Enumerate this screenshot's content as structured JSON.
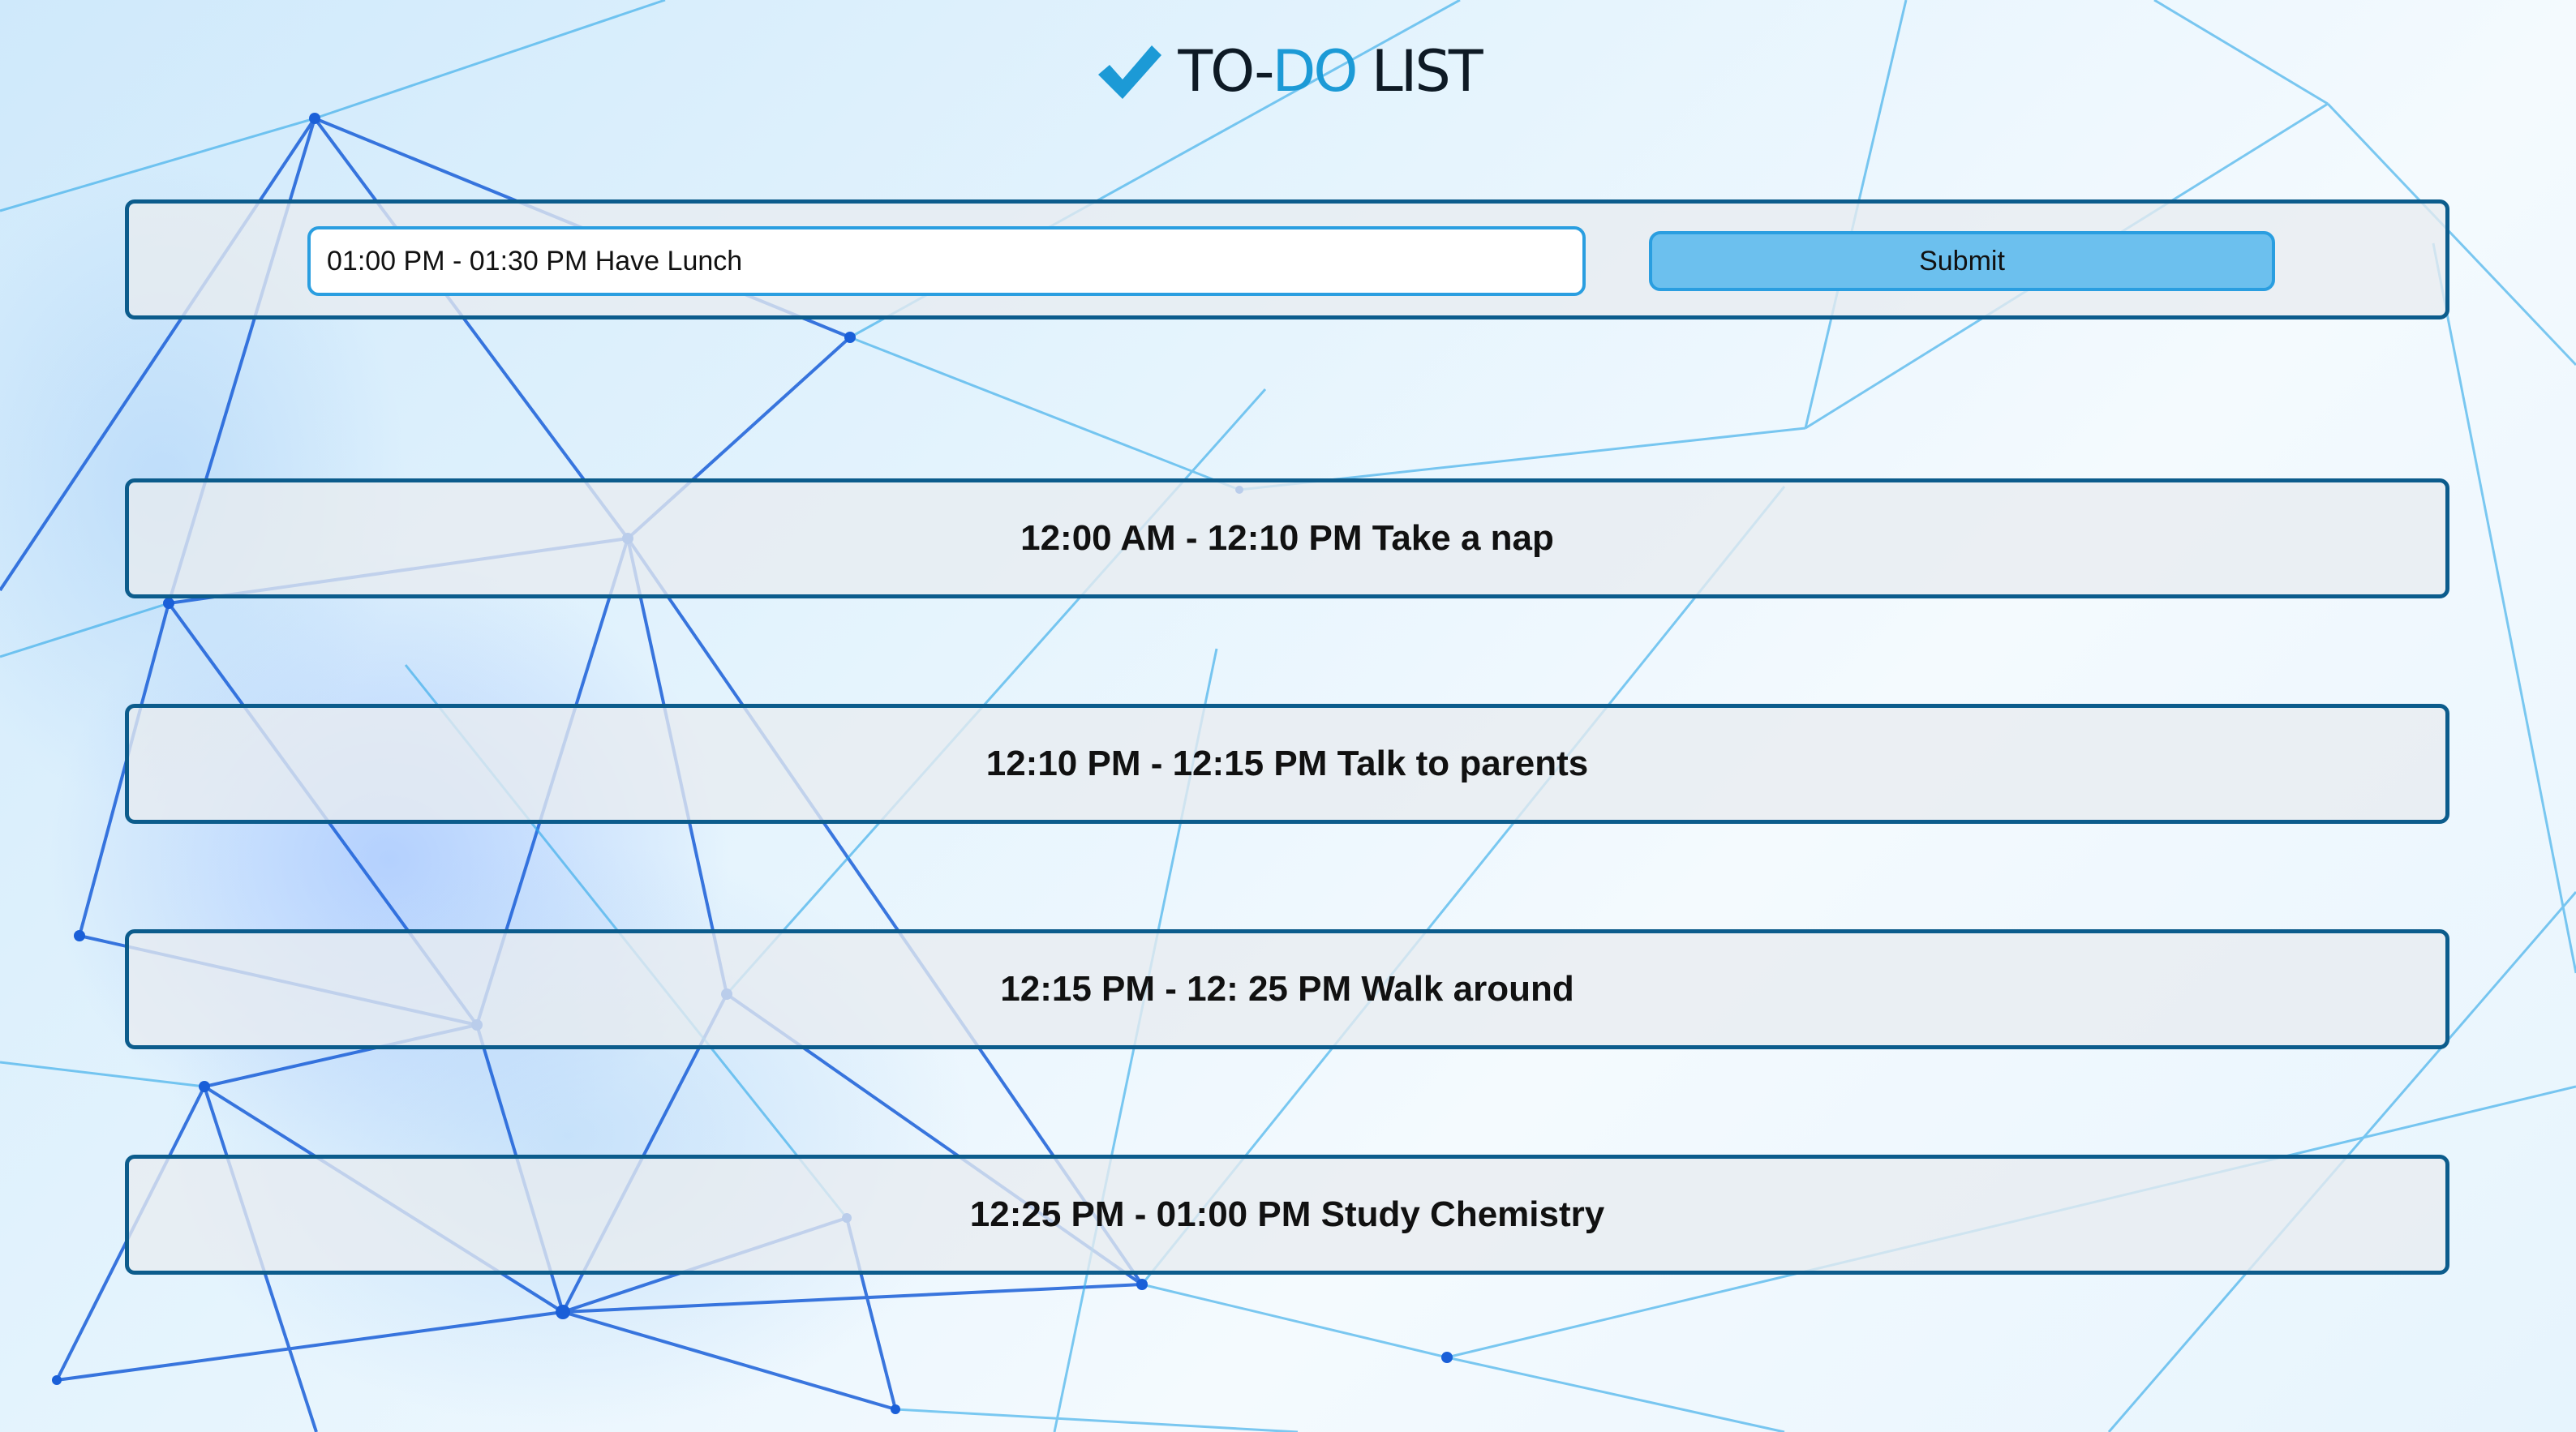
{
  "app": {
    "title_part1": "TO-",
    "title_part2": "DO",
    "title_part3": " LIST",
    "accent_color": "#1c9ad6",
    "logo_icon": "checkmark-icon"
  },
  "form": {
    "input_value": "01:00 PM - 01:30 PM Have Lunch",
    "submit_label": "Submit"
  },
  "todos": [
    {
      "text": "12:00 AM - 12:10 PM Take a nap"
    },
    {
      "text": "12:10 PM - 12:15 PM Talk to parents"
    },
    {
      "text": "12:15 PM - 12: 25 PM Walk around"
    },
    {
      "text": "12:25 PM - 01:00 PM Study Chemistry"
    }
  ],
  "colors": {
    "panel_border": "#0c5c8c",
    "button_fill": "#6cc0ee",
    "input_border": "#2a9ee0"
  }
}
